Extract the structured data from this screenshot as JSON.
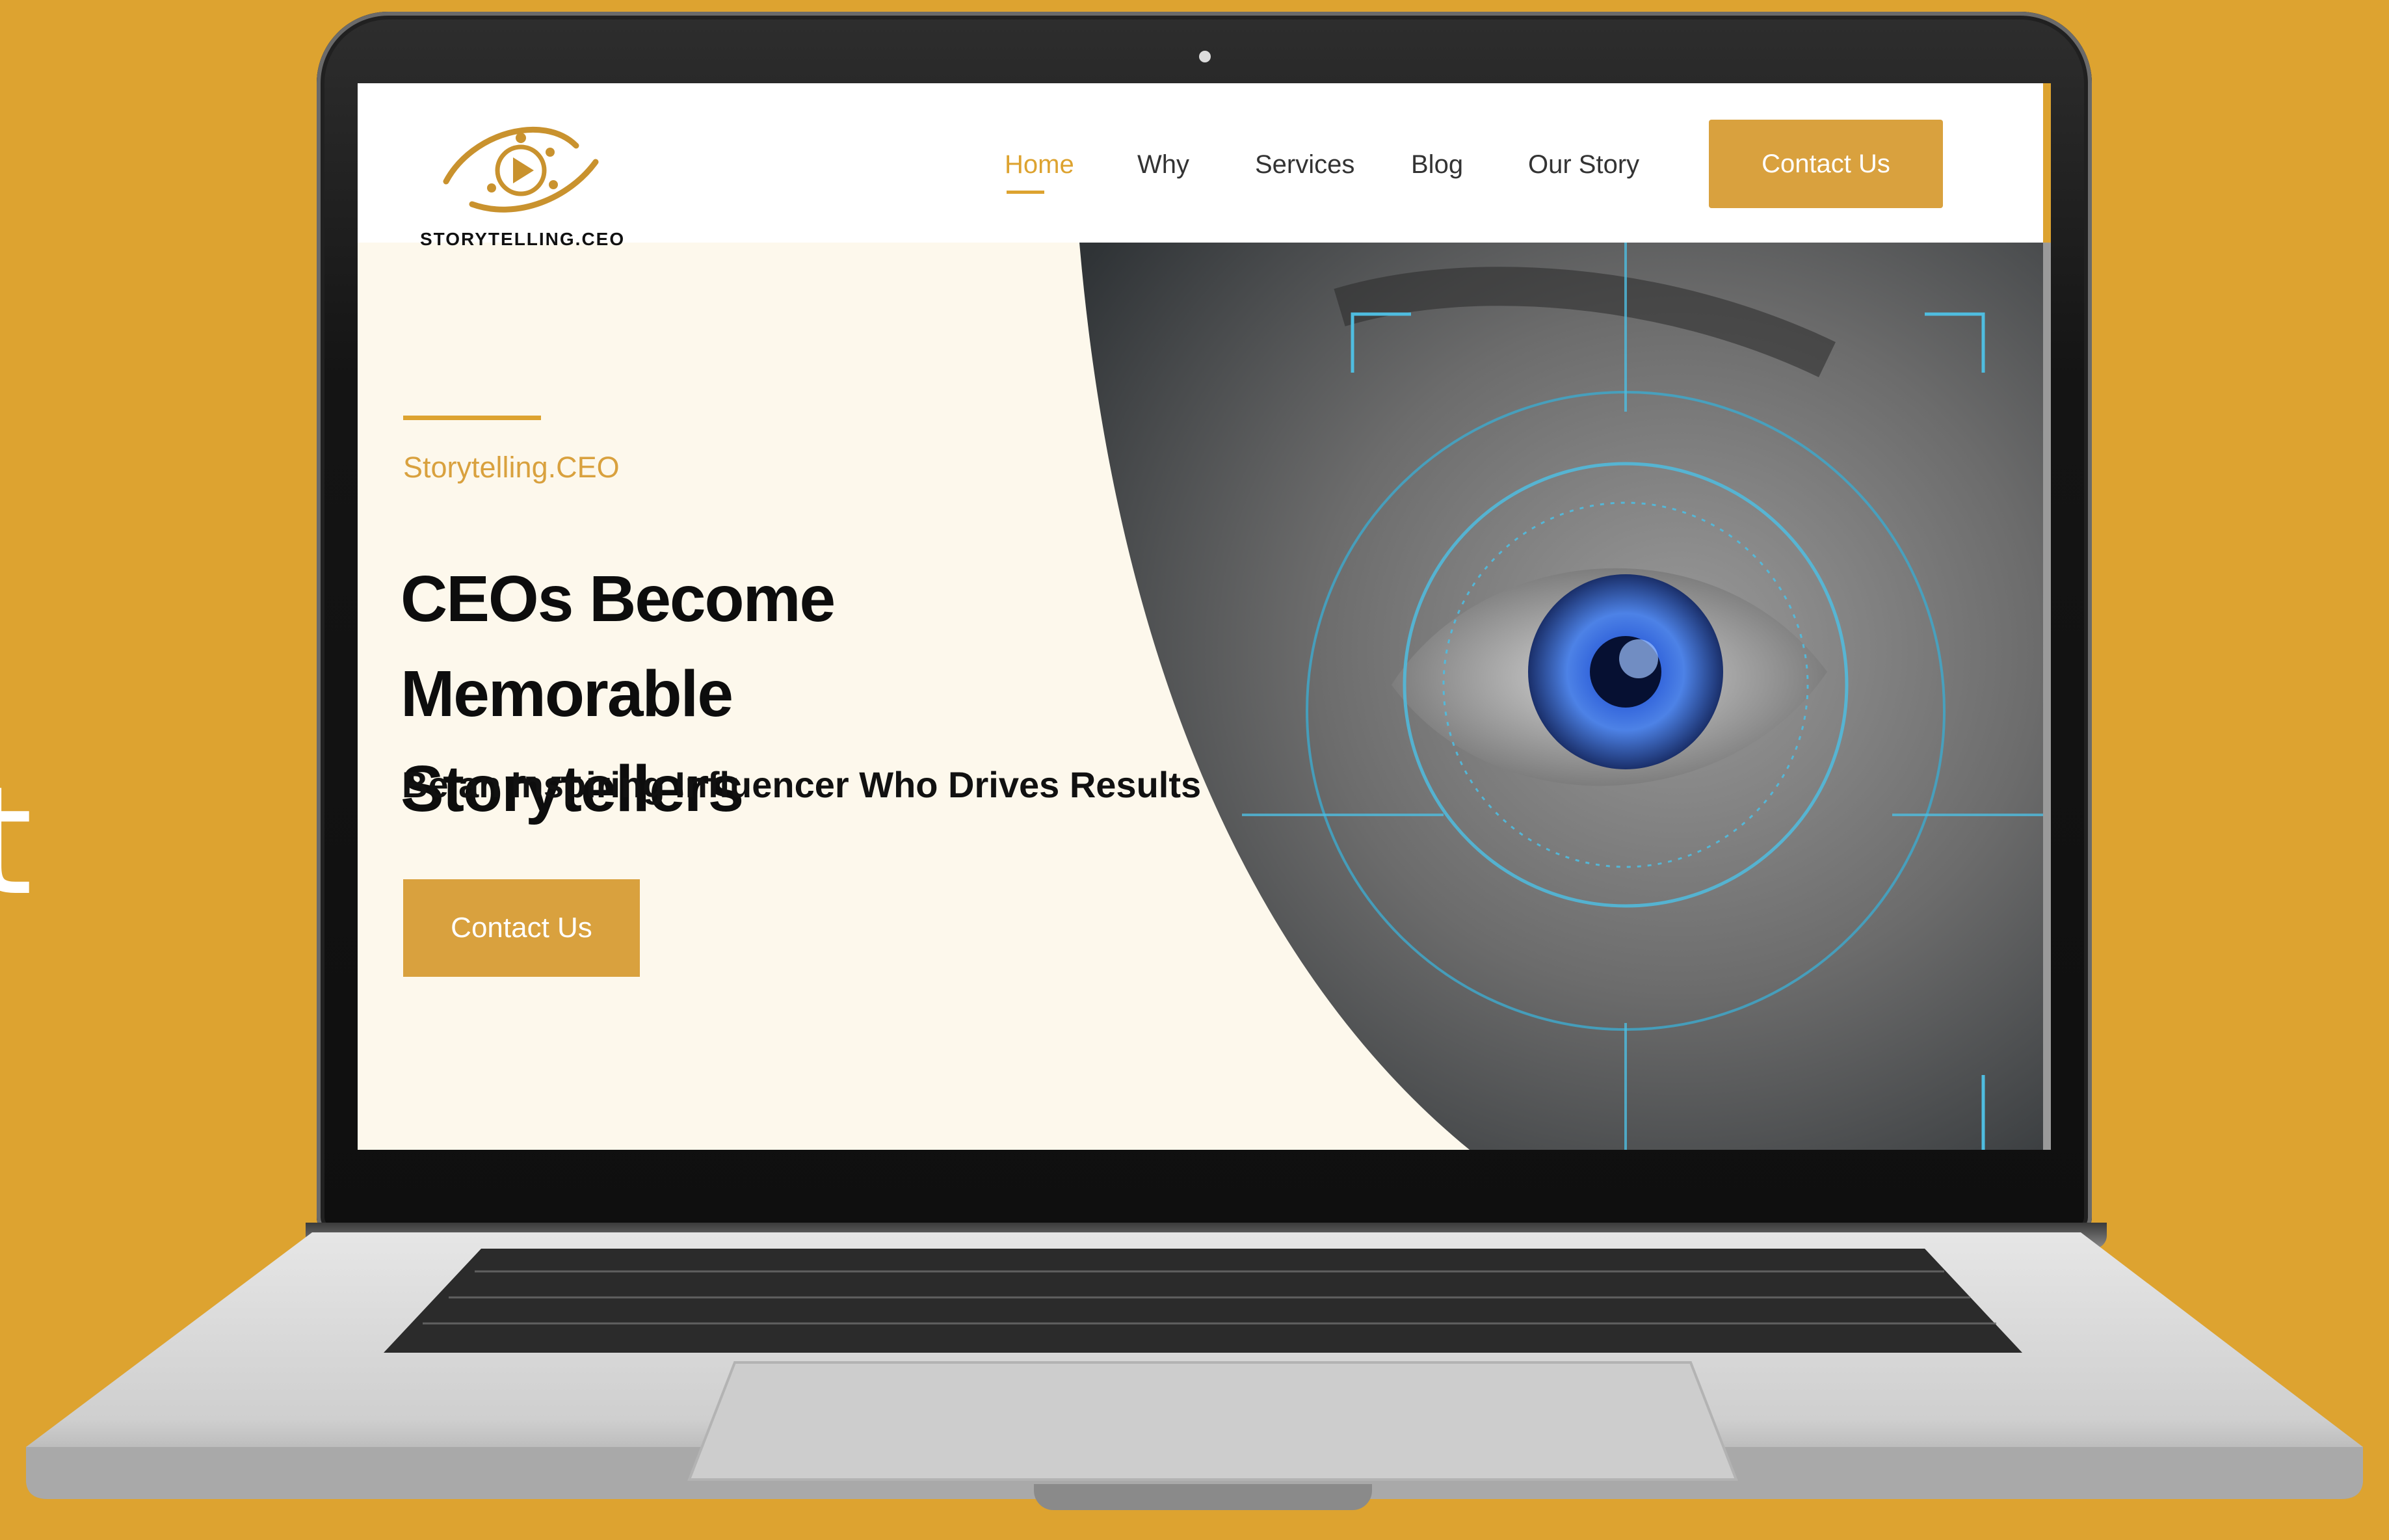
{
  "background_text": "t",
  "colors": {
    "background": "#DDA330",
    "accent": "#D9A13E",
    "hero_background": "#FDF8EC",
    "text_dark": "#0d0d0d"
  },
  "site": {
    "logo_text": "STORYTELLING.CEO",
    "nav": {
      "home": "Home",
      "why": "Why",
      "services": "Services",
      "blog": "Blog",
      "our_story": "Our Story"
    },
    "header_cta": "Contact Us"
  },
  "hero": {
    "eyebrow": "Storytelling.CEO",
    "title_line1": "CEOs Become Memorable",
    "title_line2": "Storytellers",
    "subtitle": "Be an Inspiring Influencer Who Drives Results",
    "cta": "Contact Us",
    "image_icon": "eye-scan-image"
  }
}
